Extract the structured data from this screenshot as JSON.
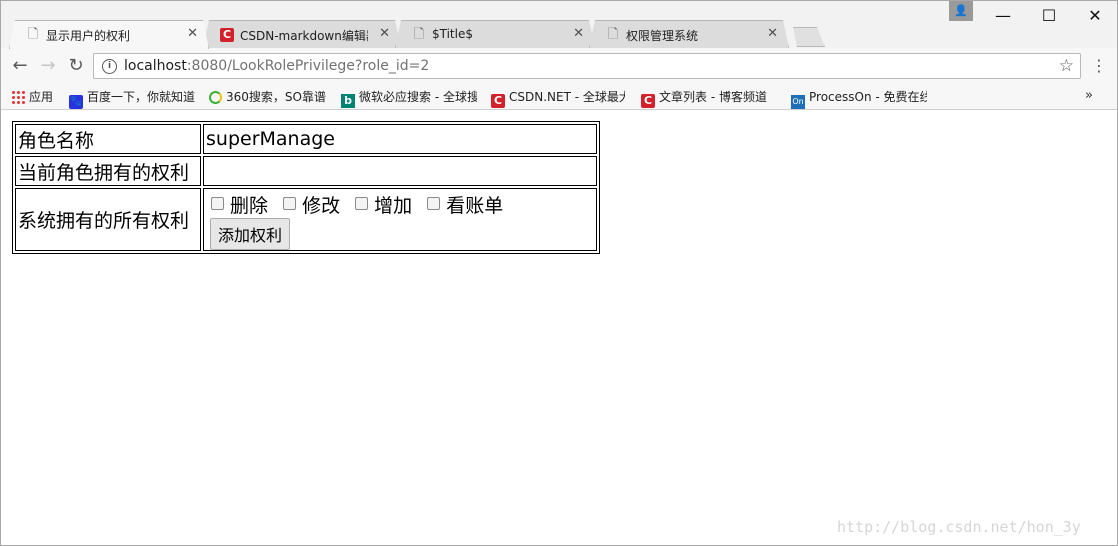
{
  "browser": {
    "tabs": [
      {
        "label": "显示用户的权利",
        "icon": "document-icon"
      },
      {
        "label": "CSDN-markdown编辑器",
        "icon": "csdn-icon"
      },
      {
        "label": "$Title$",
        "icon": "document-icon"
      },
      {
        "label": "权限管理系统",
        "icon": "document-icon"
      }
    ],
    "window_controls": {
      "minimize": "—",
      "maximize": "☐",
      "close": "✕"
    },
    "url_host": "localhost",
    "url_path": ":8080/LookRolePrivilege?role_id=2",
    "bookmarks": [
      {
        "label": "应用",
        "icon": "apps-grid-icon"
      },
      {
        "label": "百度一下，你就知道",
        "icon": "baidu-paw-icon"
      },
      {
        "label": "360搜索，SO靠谱",
        "icon": "so360-icon"
      },
      {
        "label": "微软必应搜索 - 全球搜",
        "icon": "bing-icon"
      },
      {
        "label": "CSDN.NET - 全球最大",
        "icon": "csdn-icon"
      },
      {
        "label": "文章列表 - 博客频道",
        "icon": "csdn-icon"
      },
      {
        "label": "ProcessOn - 免费在线",
        "icon": "processon-icon"
      }
    ],
    "bookmarks_more": "»"
  },
  "page": {
    "role_name_label": "角色名称",
    "role_name_value": "superManage",
    "current_privileges_label": "当前角色拥有的权利",
    "all_privileges_label": "系统拥有的所有权利",
    "privileges": [
      "删除",
      "修改",
      "增加",
      "看账单"
    ],
    "add_button": "添加权利"
  },
  "watermark": "http://blog.csdn.net/hon_3y"
}
